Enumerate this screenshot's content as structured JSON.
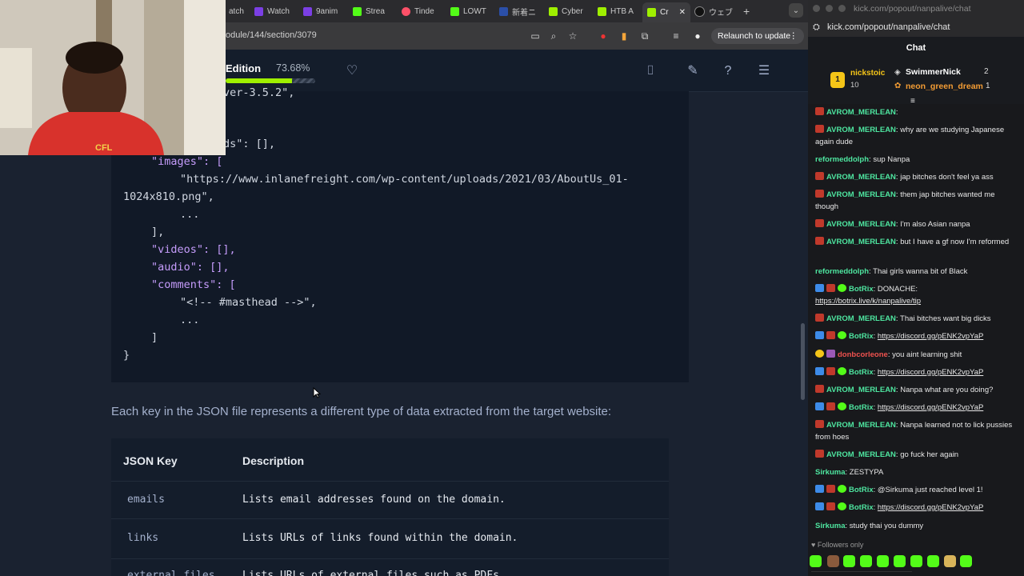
{
  "browser": {
    "tabs": [
      "atch",
      "Watch",
      "9anim",
      "Strea",
      "Tinde",
      "LOWT",
      "新着ニ",
      "Cyber",
      "HTB A",
      "Cr",
      "ウェブ"
    ],
    "url": "odule/144/section/3079",
    "relaunch_label": "Relaunch to update"
  },
  "module": {
    "edition_label": "Edition",
    "progress_text": "73.68%",
    "progress_value": 0.7368
  },
  "code": {
    "lines": [
      "ver-3.5.2\",",
      "ds\": [],",
      "\"images\": [",
      "\"https://www.inlanefreight.com/wp-content/uploads/2021/03/AboutUs_01-",
      "1024x810.png\",",
      "...",
      "],",
      "\"videos\": [],",
      "\"audio\": [],",
      "\"comments\": [",
      "\"<!-- #masthead -->\",",
      "...",
      "]",
      "}"
    ]
  },
  "content": {
    "paragraph": "Each key in the JSON file represents a different type of data extracted from the target website:",
    "table": {
      "headers": [
        "JSON Key",
        "Description"
      ],
      "rows": [
        {
          "key": "emails",
          "desc": "Lists email addresses found on the domain."
        },
        {
          "key": "links",
          "desc": "Lists URLs of links found within the domain."
        },
        {
          "key": "external_files",
          "desc": "Lists URLs of external files such as PDFs."
        }
      ]
    }
  },
  "webcam": {
    "shirt_text": "CFL"
  },
  "chat": {
    "window_title": "kick.com/popout/nanpalive/chat",
    "url": "kick.com/popout/nanpalive/chat",
    "title": "Chat",
    "leaderboard": [
      {
        "rank": "1",
        "name": "nickstoic",
        "count": "10"
      },
      {
        "name": "SwimmerNick",
        "count": "2"
      },
      {
        "name": "neon_green_dream",
        "count": "1"
      }
    ],
    "messages": [
      {
        "user": "AVROM_MERLEAN",
        "color": "#4ee6a0",
        "text": ""
      },
      {
        "user": "AVROM_MERLEAN",
        "color": "#4ee6a0",
        "text": "why are we studying Japanese again dude"
      },
      {
        "user": "reformeddolph",
        "color": "#4ee6a0",
        "text": "sup Nanpa"
      },
      {
        "user": "AVROM_MERLEAN",
        "color": "#4ee6a0",
        "text": "jap bitches don't feel ya ass"
      },
      {
        "user": "AVROM_MERLEAN",
        "color": "#4ee6a0",
        "text": "them jap bitches wanted me though"
      },
      {
        "user": "AVROM_MERLEAN",
        "color": "#4ee6a0",
        "text": "I'm also Asian nanpa"
      },
      {
        "user": "AVROM_MERLEAN",
        "color": "#4ee6a0",
        "text": "but I have a gf now I'm reformed"
      },
      {
        "user": "reformeddolph",
        "color": "#4ee6a0",
        "text": "Thai girls wanna bit of Black"
      },
      {
        "user": "BotRix",
        "color": "#4ee6a0",
        "text": "DONACHE:",
        "link": "https://botrix.live/k/nanpalive/tip"
      },
      {
        "user": "AVROM_MERLEAN",
        "color": "#4ee6a0",
        "text": "Thai bitches want big dicks"
      },
      {
        "user": "BotRix",
        "color": "#4ee6a0",
        "text": "",
        "link": "https://discord.gg/pENK2vpYaP"
      },
      {
        "user": "donbcorleone",
        "color": "#f0524f",
        "text": "you aint learning shit"
      },
      {
        "user": "BotRix",
        "color": "#4ee6a0",
        "text": "",
        "link": "https://discord.gg/pENK2vpYaP"
      },
      {
        "user": "AVROM_MERLEAN",
        "color": "#4ee6a0",
        "text": "Nanpa what are you doing?"
      },
      {
        "user": "BotRix",
        "color": "#4ee6a0",
        "text": "",
        "link": "https://discord.gg/pENK2vpYaP"
      },
      {
        "user": "AVROM_MERLEAN",
        "color": "#4ee6a0",
        "text": "Nanpa learned not to lick pussies from hoes"
      },
      {
        "user": "AVROM_MERLEAN",
        "color": "#4ee6a0",
        "text": "go fuck her again"
      },
      {
        "user": "Sirkuma",
        "color": "#4ee6a0",
        "text": "ZESTYPA"
      },
      {
        "user": "BotRix",
        "color": "#4ee6a0",
        "text": "@Sirkuma just reached level 1!"
      },
      {
        "user": "BotRix",
        "color": "#4ee6a0",
        "text": "",
        "link": "https://discord.gg/pENK2vpYaP"
      },
      {
        "user": "Sirkuma",
        "color": "#4ee6a0",
        "text": "study thai you dummy"
      }
    ],
    "followers_only": "Followers only"
  },
  "colors": {
    "accent": "#9fef00",
    "chat_green": "#53fc18",
    "bg": "#1a2230"
  }
}
